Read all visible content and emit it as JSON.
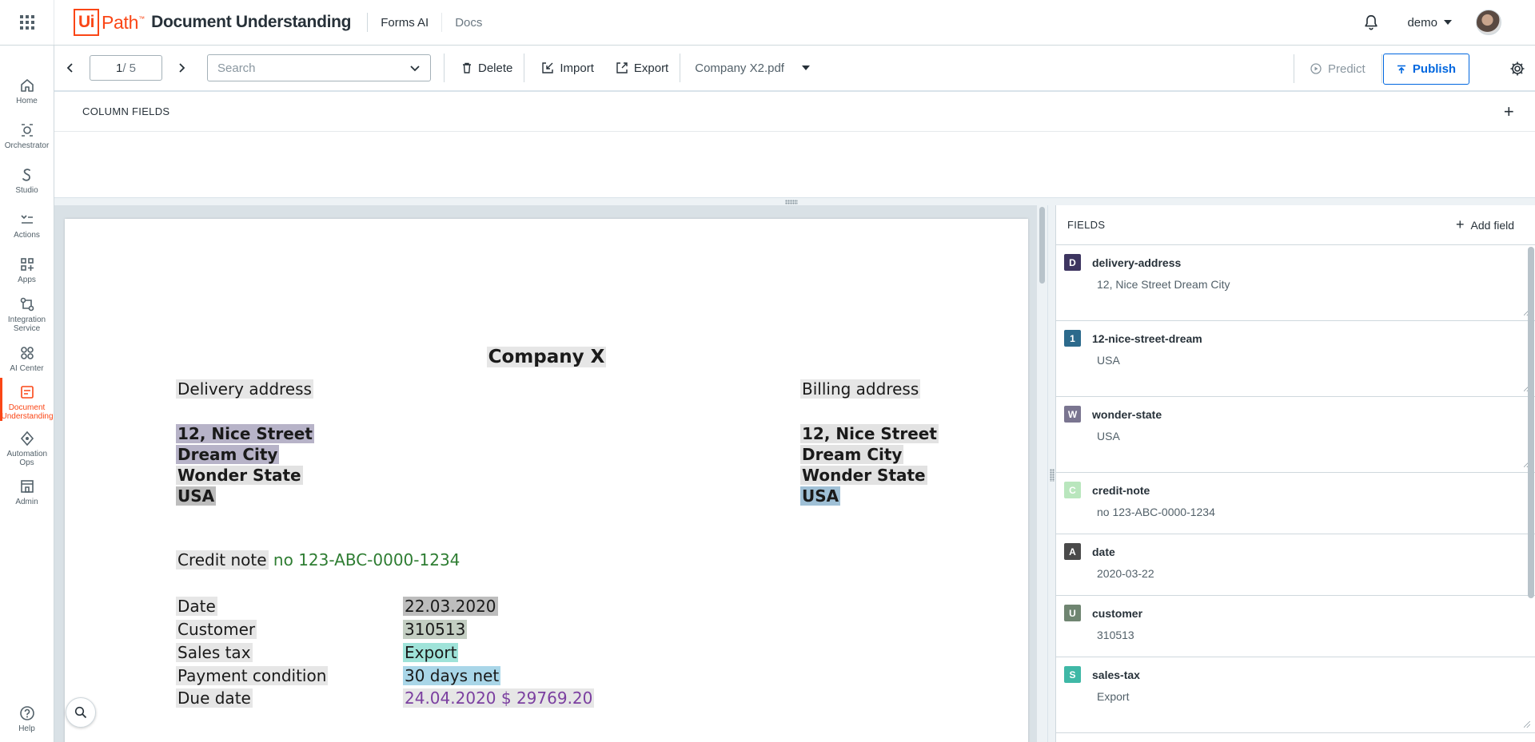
{
  "header": {
    "logo_ui": "Ui",
    "logo_path": "Path",
    "logo_tm": "™",
    "product": "Document Understanding",
    "links": [
      "Forms AI",
      "Docs"
    ],
    "user": "demo"
  },
  "nav": [
    {
      "label": "Home",
      "icon": "home-icon"
    },
    {
      "label": "Orchestrator",
      "icon": "orchestrator-icon"
    },
    {
      "label": "Studio",
      "icon": "studio-icon"
    },
    {
      "label": "Actions",
      "icon": "actions-icon"
    },
    {
      "label": "Apps",
      "icon": "apps-icon"
    },
    {
      "label": "Integration Service",
      "icon": "integration-icon"
    },
    {
      "label": "AI Center",
      "icon": "ai-center-icon"
    },
    {
      "label": "Document Understanding",
      "icon": "document-understanding-icon",
      "active": true
    },
    {
      "label": "Automation Ops",
      "icon": "automation-ops-icon"
    },
    {
      "label": "Admin",
      "icon": "admin-icon"
    },
    {
      "label": "Help",
      "icon": "help-icon"
    }
  ],
  "toolbar": {
    "page_current": "1",
    "page_total": "/ 5",
    "search_placeholder": "Search",
    "delete_label": "Delete",
    "import_label": "Import",
    "export_label": "Export",
    "filename": "Company X2.pdf",
    "predict_label": "Predict",
    "publish_label": "Publish"
  },
  "column_fields": {
    "title": "COLUMN FIELDS",
    "add": "+"
  },
  "document": {
    "title": "Company X",
    "delivery_label": "Delivery address",
    "billing_label": "Billing address",
    "delivery_lines": [
      "12, Nice Street",
      "Dream City",
      "Wonder State",
      "USA"
    ],
    "billing_lines": [
      "12, Nice Street",
      "Dream City",
      "Wonder State",
      "USA"
    ],
    "credit_label": "Credit note",
    "credit_value": "no 123-ABC-0000-1234",
    "rows": [
      {
        "label": "Date",
        "value": "22.03.2020"
      },
      {
        "label": "Customer",
        "value": "310513"
      },
      {
        "label": "Sales tax",
        "value": "Export"
      },
      {
        "label": "Payment condition",
        "value": "30 days net"
      },
      {
        "label": "Due date",
        "value": "24.04.2020 $ 29769.20"
      }
    ]
  },
  "fields_panel": {
    "title": "FIELDS",
    "add_label": "Add field",
    "fields": [
      {
        "badge": "D",
        "color": "#3d3560",
        "name": "delivery-address",
        "value": "12, Nice Street Dream City"
      },
      {
        "badge": "1",
        "color": "#2c6a8c",
        "name": "12-nice-street-dream",
        "value": "USA"
      },
      {
        "badge": "W",
        "color": "#7a7590",
        "name": "wonder-state",
        "value": "USA"
      },
      {
        "badge": "C",
        "color": "#b9e6bd",
        "name": "credit-note",
        "value": "no 123-ABC-0000-1234"
      },
      {
        "badge": "A",
        "color": "#4a4a4a",
        "name": "date",
        "value": "2020-03-22"
      },
      {
        "badge": "U",
        "color": "#6f8571",
        "name": "customer",
        "value": "310513"
      },
      {
        "badge": "S",
        "color": "#3fb8a6",
        "name": "sales-tax",
        "value": "Export"
      }
    ]
  }
}
